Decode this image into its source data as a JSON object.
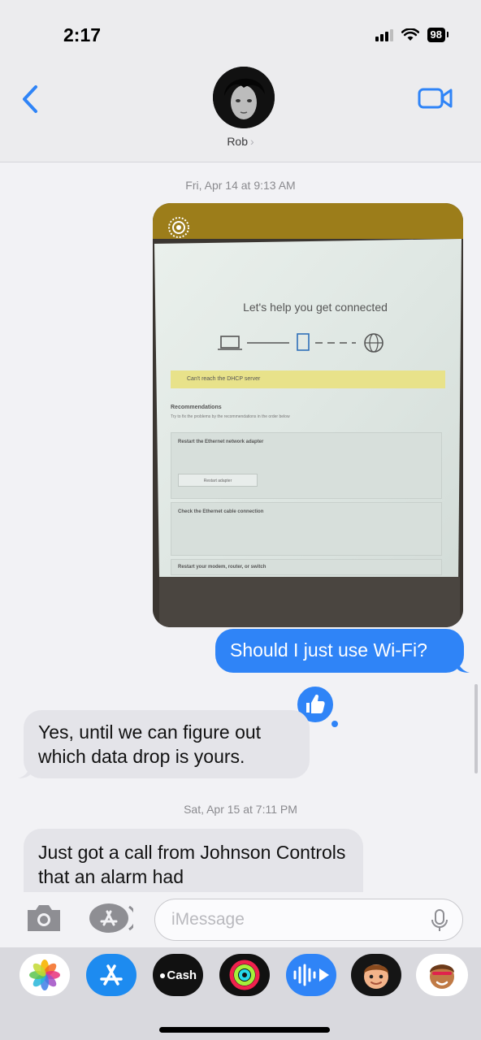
{
  "status_bar": {
    "time": "2:17",
    "battery": "98"
  },
  "header": {
    "contact_name": "Rob",
    "name_chevron": "›"
  },
  "messages": [
    {
      "kind": "timestamp",
      "text": "Fri, Apr 14 at 9:13 AM"
    },
    {
      "kind": "photo",
      "direction": "outgoing",
      "screen": {
        "heading": "Let's help you get connected",
        "alert": "Can't reach the DHCP server",
        "recommendations_title": "Recommendations",
        "recommendations_sub": "Try to fix the problems by the recommendations in the order below",
        "cards": [
          {
            "title": "Restart the Ethernet network adapter",
            "button": "Restart adapter"
          },
          {
            "title": "Check the Ethernet cable connection"
          },
          {
            "title": "Restart your modem, router, or switch"
          }
        ]
      }
    },
    {
      "kind": "text",
      "direction": "outgoing",
      "text": "Should I just use Wi-Fi?"
    },
    {
      "kind": "text",
      "direction": "incoming",
      "text": "Yes, until we can figure out which data drop is yours.",
      "reaction": "thumbs-up"
    },
    {
      "kind": "timestamp",
      "text": "Sat, Apr 15 at 7:11 PM"
    },
    {
      "kind": "text",
      "direction": "incoming",
      "text": "Just got a call from Johnson Controls that an alarm had"
    }
  ],
  "compose": {
    "placeholder": "iMessage"
  },
  "app_drawer": {
    "apps": [
      {
        "name": "photos"
      },
      {
        "name": "app-store"
      },
      {
        "name": "apple-cash",
        "label": "Cash"
      },
      {
        "name": "fitness"
      },
      {
        "name": "audio-message"
      },
      {
        "name": "memoji"
      },
      {
        "name": "animoji"
      }
    ]
  },
  "colors": {
    "accent": "#2f84f7",
    "incoming_bubble": "#e4e4e9",
    "page_background": "#f2f2f5"
  }
}
